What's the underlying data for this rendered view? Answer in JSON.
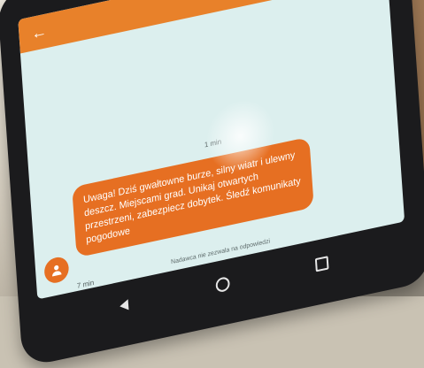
{
  "app": {
    "back_icon": "arrow-left-icon",
    "title": "",
    "accent_color": "#e8812a"
  },
  "conversation": {
    "date_separator": "1 min",
    "message": {
      "text": "Uwaga! Dziś gwałtowne burze, silny wiatr i ulewny deszcz. Miejscami grad. Unikaj otwartych przestrzeni, zabezpiecz dobytek. Śledź komunikaty pogodowe",
      "time": "7 min",
      "bubble_color": "#e66f22"
    },
    "reply_note": "Nadawca nie zezwala na odpowiedzi"
  },
  "navigation": {
    "buttons": [
      "back",
      "home",
      "recents"
    ]
  }
}
